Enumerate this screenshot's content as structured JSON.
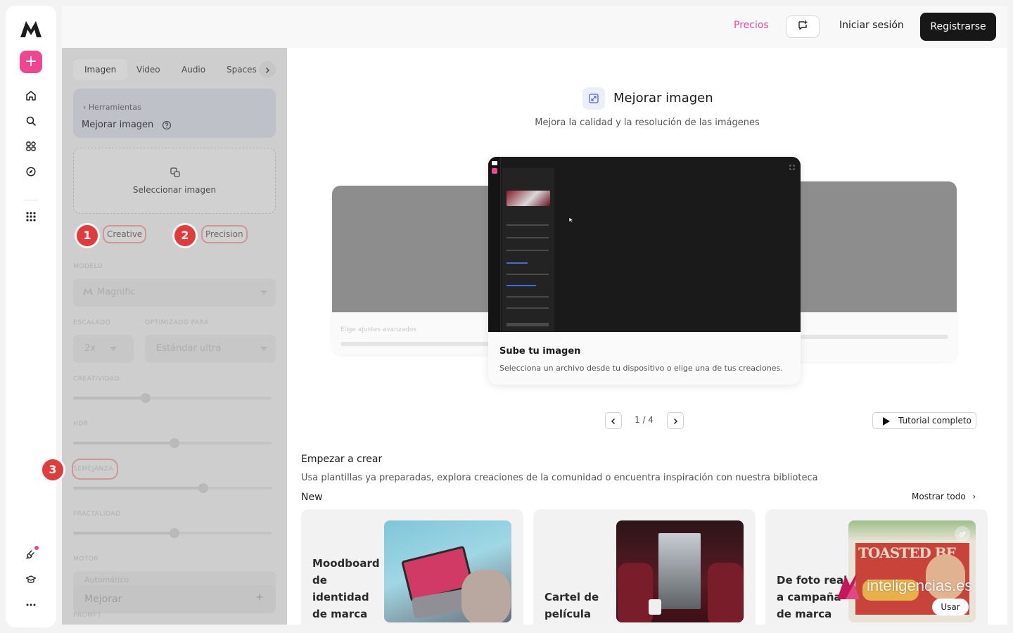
{
  "sidebar": {
    "logo": "M-logo",
    "new_button": "+",
    "icons": [
      "home-icon",
      "search-icon",
      "grid-icon",
      "explore-icon",
      "apps-icon",
      "plug-icon",
      "learn-icon",
      "more-icon"
    ]
  },
  "topbar": {
    "precios": "Precios",
    "login": "Iniciar sesión",
    "register": "Registrarse"
  },
  "panel": {
    "tabs": [
      "Imagen",
      "Video",
      "Audio",
      "Spaces"
    ],
    "breadcrumb": "Herramientas",
    "tool_title": "Mejorar imagen",
    "dropzone_label": "Seleccionar imagen",
    "modes": [
      "Creative",
      "Precision"
    ],
    "fields": {
      "model_label": "MODELO",
      "model_value": "Magnific",
      "scale_label": "ESCALADO",
      "optimize_label": "OPTIMIZADO PARA",
      "scale_value": "2x",
      "optimize_value": "Estándar ultra",
      "creativity_label": "CREATIVIDAD",
      "hdr_label": "HDR",
      "resemblance_label": "SEMEJANZA",
      "fractality_label": "FRACTALIDAD",
      "engine_label": "MOTOR",
      "prompt_label": "PROMPT",
      "prompt_value": "Automático"
    },
    "submit": "Mejorar",
    "step_badges": [
      "1",
      "2",
      "3"
    ]
  },
  "main": {
    "title": "Mejorar imagen",
    "subtitle": "Mejora la calidad y la resolución de las imágenes",
    "carousel": {
      "card_title": "Sube tu imagen",
      "card_desc": "Selecciona un archivo desde tu dispositivo o elige una de tus creaciones.",
      "ghost_left": "Elige ajustes avanzados",
      "pager": "1 / 4"
    },
    "tutorial": "Tutorial completo",
    "section_title": "Empezar a crear",
    "section_sub": "Usa plantillas ya preparadas, explora creaciones de la comunidad o encuentra inspiración con nuestra biblioteca",
    "new_label": "New",
    "show_all": "Mostrar todo",
    "templates": [
      {
        "title_lines": [
          "Moodboard",
          "de",
          "identidad",
          "de marca"
        ]
      },
      {
        "title_lines": [
          "Cartel de",
          "película"
        ]
      },
      {
        "title_lines": [
          "De foto real",
          "a campaña",
          "de marca"
        ],
        "use": "Usar",
        "poster": "TOASTED BF"
      }
    ],
    "watermark": "inteligencias.es"
  },
  "colors": {
    "accent_pink": "#f0468f",
    "badge_red": "#e23b3b",
    "dark": "#171717"
  }
}
